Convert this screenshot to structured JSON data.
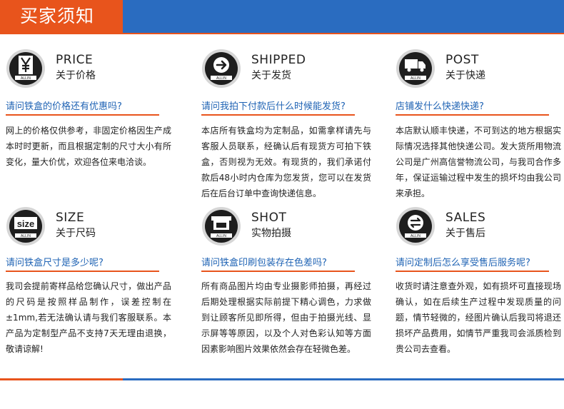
{
  "header": {
    "title": "买家须知"
  },
  "colors": {
    "accent_orange": "#e8541c",
    "brand_blue": "#2a6cc0",
    "question_blue": "#1f63b4",
    "badge_dark": "#1e1e1e"
  },
  "faqs": [
    {
      "eng": "PRICE",
      "cn": "关于价格",
      "icon": "yen-icon",
      "badge_label": "ALLIN",
      "question": "请问铁盒的价格还有优惠吗?",
      "answer": "网上的价格仅供参考，非固定价格因生产成本时时更新，而且根据定制的尺寸大小有所变化，量大价优，欢迎各位来电洽谈。"
    },
    {
      "eng": "SHIPPED",
      "cn": "关于发货",
      "icon": "arrow-right-icon",
      "badge_label": "ALLIN",
      "question": "请问我拍下付款后什么时候能发货?",
      "answer": "本店所有铁盒均为定制品，如需拿样请先与客服人员联系，经确认后有现货方可拍下铁盒，否则视为无效。有现货的，我们承诺付款后48小时内仓库为您发货，您可以在发货后在后台订单中查询快递信息。"
    },
    {
      "eng": "POST",
      "cn": "关于快递",
      "icon": "truck-icon",
      "badge_label": "ALLIN",
      "question": "店铺发什么快递快递?",
      "answer": "本店默认顺丰快递，不可到达的地方根据实际情况选择其他快递公司。发大货所用物流公司是广州高信誉物流公司，与我司合作多年，保证运输过程中发生的损坏均由我公司来承担。"
    },
    {
      "eng": "SIZE",
      "cn": "关于尺码",
      "icon": "size-icon",
      "badge_label": "ALLIN",
      "badge_text": "size",
      "question": "请问铁盒尺寸是多少呢?",
      "answer": "我司会提前寄样品给您确认尺寸，做出产品的尺码是按照样品制作，误差控制在±1mm,若无法确认请与我们客服联系。本产品为定制型产品不支持7天无理由退换，敬请谅解!"
    },
    {
      "eng": "SHOT",
      "cn": "实物拍摄",
      "icon": "tin-box-icon",
      "badge_label": "ALLIN",
      "question": "请问铁盒印刷包装存在色差吗?",
      "answer": "所有商品图片均由专业摄影师拍摄，再经过后期处理根据实际前提下精心调色，力求做到让顾客所见即所得，但由于拍摄光线、显示屏等等原因，以及个人对色彩认知等方面因素影响图片效果依然会存在轻微色差。"
    },
    {
      "eng": "SALES",
      "cn": "关于售后",
      "icon": "exchange-icon",
      "badge_label": "ALLIN",
      "question": "请问定制后怎么享受售后服务呢?",
      "answer": "收货时请注意查外观，如有损坏可直接现场确认，如在后续生产过程中发现质量的问题，情节轻微的，经图片确认后我司将退还损坏产品费用，如情节严重我司会派质检到贵公司去查看。"
    }
  ]
}
